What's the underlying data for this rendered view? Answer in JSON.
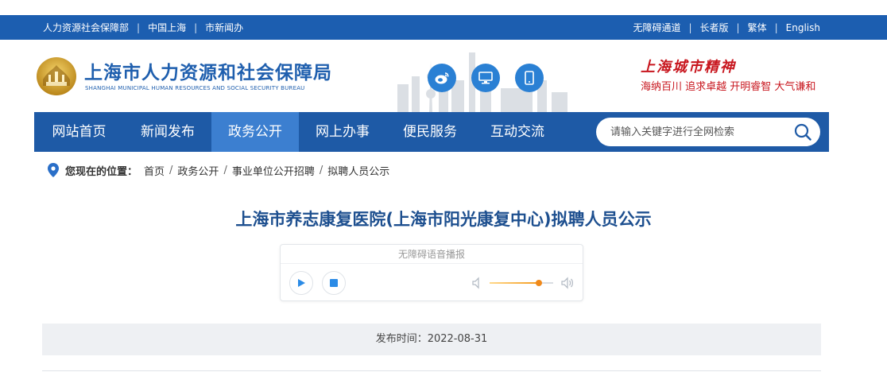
{
  "topbar": {
    "left_links": [
      "人力资源社会保障部",
      "中国上海",
      "市新闻办"
    ],
    "right_links": [
      "无障碍通道",
      "长者版",
      "繁体",
      "English"
    ]
  },
  "header": {
    "site_name": "上海市人力资源和社会保障局",
    "site_name_en": "SHANGHAI MUNICIPAL HUMAN RESOURCES AND SOCIAL SECURITY BUREAU",
    "social_icons": [
      "weibo-icon",
      "desktop-icon",
      "mobile-icon"
    ],
    "spirit_title": "上海城市精神",
    "spirit_sub": "海纳百川  追求卓越  开明睿智  大气谦和",
    "accent_color": "#1f5fae",
    "spirit_color": "#c8161e"
  },
  "nav": {
    "items": [
      "网站首页",
      "新闻发布",
      "政务公开",
      "网上办事",
      "便民服务",
      "互动交流"
    ],
    "active_index": 2,
    "search_placeholder": "请输入关键字进行全网检索"
  },
  "breadcrumb": {
    "label": "您现在的位置：",
    "items": [
      "首页",
      "政务公开",
      "事业单位公开招聘",
      "拟聘人员公示"
    ]
  },
  "article": {
    "title": "上海市养志康复医院(上海市阳光康复中心)拟聘人员公示",
    "publish_label": "发布时间：2022-08-31"
  },
  "player": {
    "header": "无障碍语音播报",
    "volume": 0.78
  }
}
